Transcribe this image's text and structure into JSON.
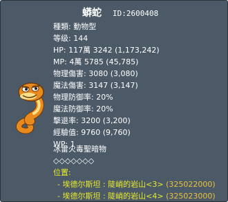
{
  "mob": {
    "name": "蟒蛇",
    "id_text": "ID:2600408"
  },
  "stats": [
    "種類: 動物型",
    "等级: 144",
    "HP: 117萬 3242 (1,173,242)",
    "MP: 4萬 5785 (45,785)",
    "物理傷害: 3080 (3,080)",
    "魔法傷害: 3147 (3,147)",
    "物理防御率: 20%",
    "魔法防御率: 20%",
    "擊退率: 3200 (3,200)",
    "經驗值: 9760 (9,760)",
    "WP: 1",
    "冰雷火毒聖暗物",
    "◇◇◇◇◇◇◇"
  ],
  "location": {
    "label": "位置:",
    "entries": [
      {
        "bullet": "- 埃德尔斯坦 : 陡峭的岩山<3>",
        "id": "(325022000)"
      },
      {
        "bullet": "- 埃德尔斯坦 : 陡峭的岩山<4>",
        "id": "(325023000)"
      }
    ]
  },
  "colors": {
    "panel_bg": "#4c5a68",
    "text": "#ffffff",
    "location": "#e8ea2b",
    "snake_body": "#e88a1c",
    "snake_belly": "#f7e08a"
  },
  "icons": {
    "monster_sprite": "orange-snake-icon"
  }
}
